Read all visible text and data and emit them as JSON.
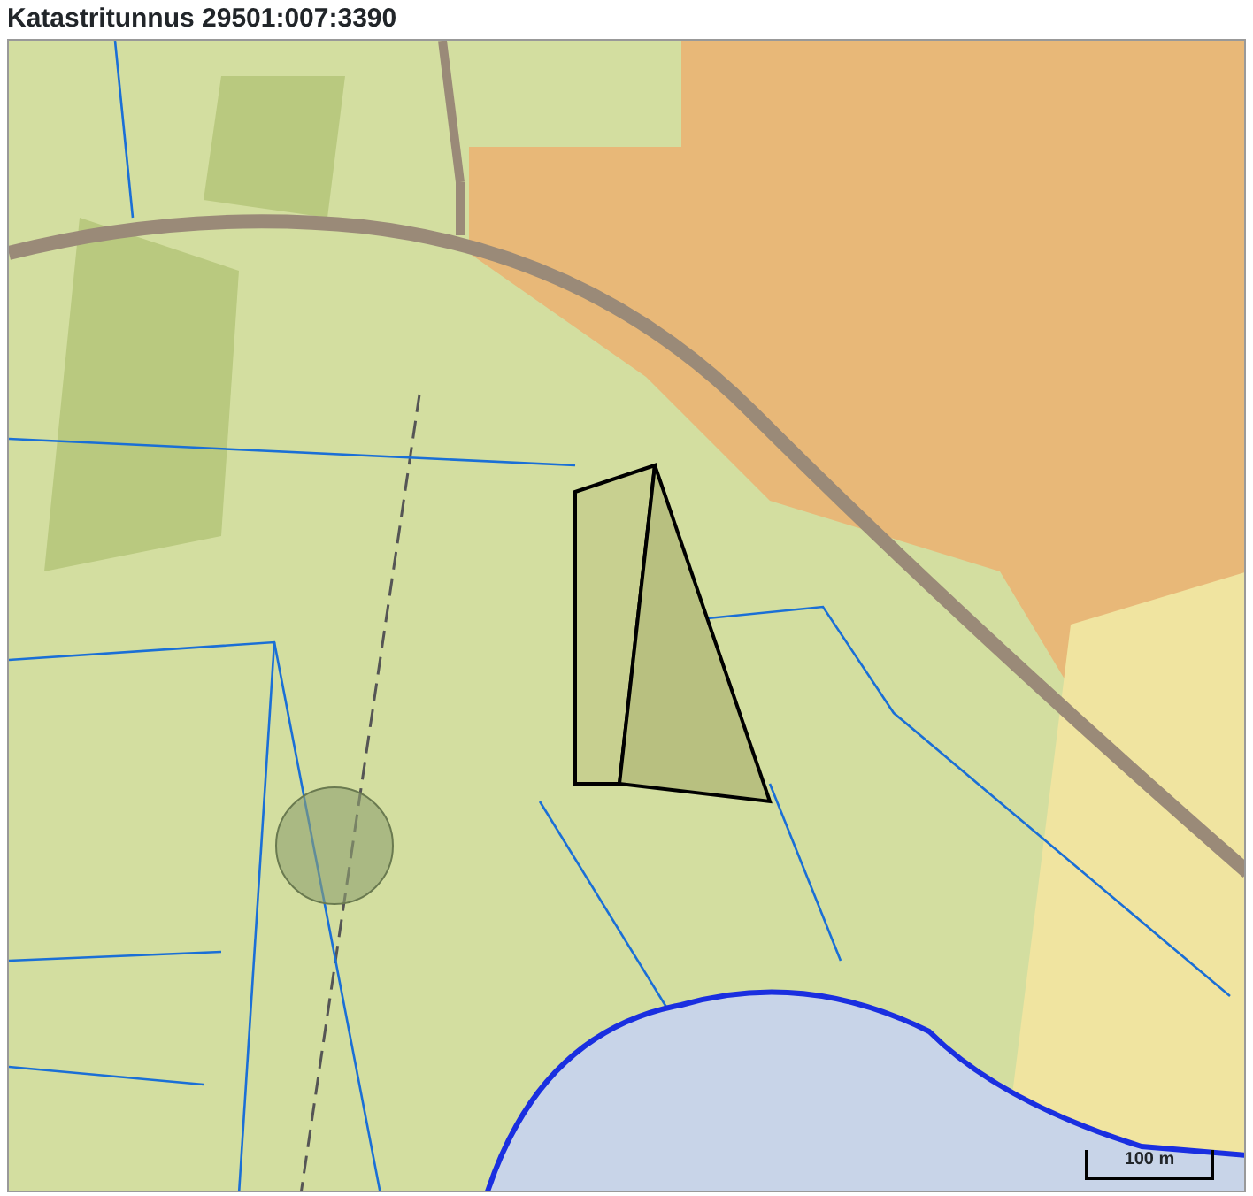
{
  "title": "Katastritunnus 29501:007:3390",
  "scale_bar": {
    "label": "100 m"
  }
}
